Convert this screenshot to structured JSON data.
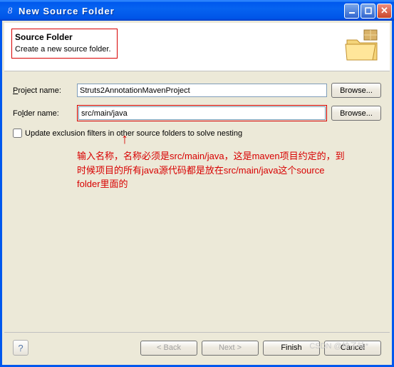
{
  "titlebar": {
    "title": "New Source Folder"
  },
  "header": {
    "title": "Source Folder",
    "subtitle": "Create a new source folder."
  },
  "form": {
    "project_label_pre": "P",
    "project_label_rest": "roject name:",
    "project_value": "Struts2AnnotationMavenProject",
    "folder_label_pre": "Fo",
    "folder_label_u": "l",
    "folder_label_rest": "der name:",
    "folder_value": "src/main/java",
    "browse1": "Browse...",
    "browse2": "Browse...",
    "checkbox_pre": "U",
    "checkbox_rest": "pdate exclusion filters in other source folders to solve nesting"
  },
  "annotation": {
    "text": "输入名称，名称必须是src/main/java，这是maven项目约定的，到时候项目的所有java源代码都是放在src/main/java这个source folder里面的"
  },
  "footer": {
    "back": "< Back",
    "next": "Next >",
    "finish": "Finish",
    "cancel": "Cancel"
  },
  "watermark": "CSDN @柚子味*"
}
